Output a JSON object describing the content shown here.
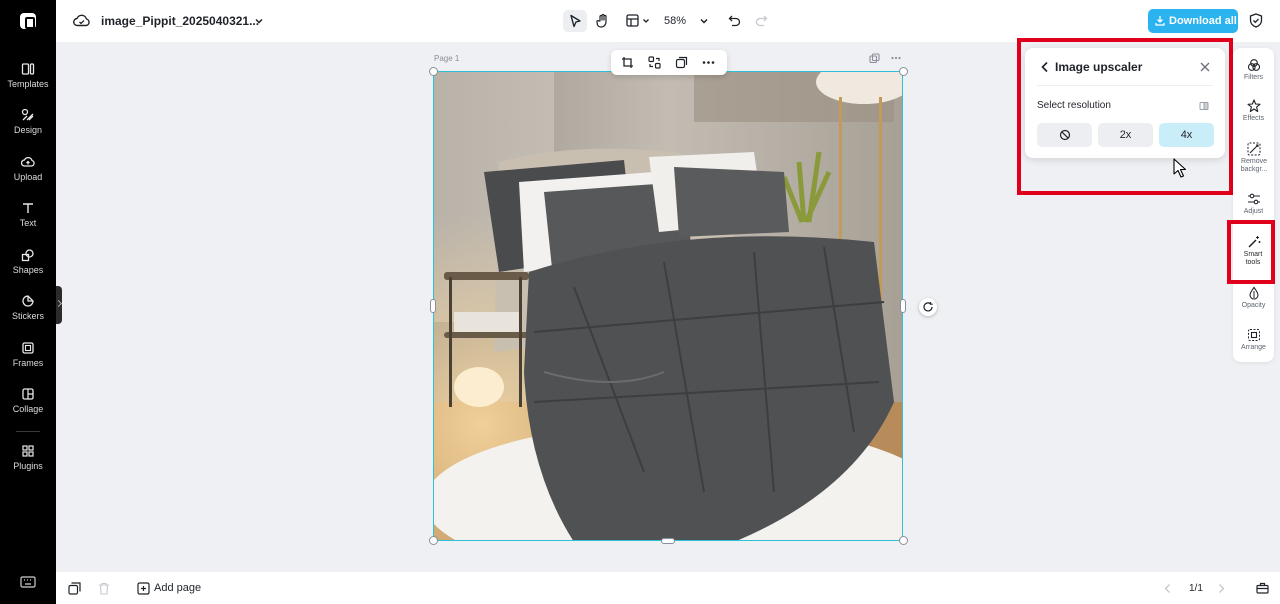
{
  "sidebar": {
    "items": [
      {
        "label": "Templates",
        "icon": "templates-icon"
      },
      {
        "label": "Design",
        "icon": "design-icon"
      },
      {
        "label": "Upload",
        "icon": "upload-icon"
      },
      {
        "label": "Text",
        "icon": "text-icon"
      },
      {
        "label": "Shapes",
        "icon": "shapes-icon"
      },
      {
        "label": "Stickers",
        "icon": "stickers-icon"
      },
      {
        "label": "Frames",
        "icon": "frames-icon"
      },
      {
        "label": "Collage",
        "icon": "collage-icon"
      },
      {
        "label": "Plugins",
        "icon": "plugins-icon"
      }
    ]
  },
  "header": {
    "file_name": "image_Pippit_2025040321...",
    "zoom": "58%",
    "download_label": "Download all"
  },
  "canvas": {
    "page_label": "Page 1"
  },
  "upscaler": {
    "title": "Image upscaler",
    "subtitle": "Select resolution",
    "options": [
      "2x",
      "4x"
    ],
    "selected": "4x"
  },
  "right_toolbar": {
    "items": [
      {
        "label": "Filters"
      },
      {
        "label": "Effects"
      },
      {
        "label": "Remove backgr..."
      },
      {
        "label": "Adjust"
      },
      {
        "label": "Smart tools"
      },
      {
        "label": "Opacity"
      },
      {
        "label": "Arrange"
      }
    ],
    "active": "Smart tools"
  },
  "footer": {
    "add_page_label": "Add page",
    "page_count": "1/1"
  },
  "colors": {
    "accent": "#2bb3f0",
    "selection": "#2ec0d6",
    "highlight": "#e0001b",
    "selected_option": "#c9eef9"
  }
}
